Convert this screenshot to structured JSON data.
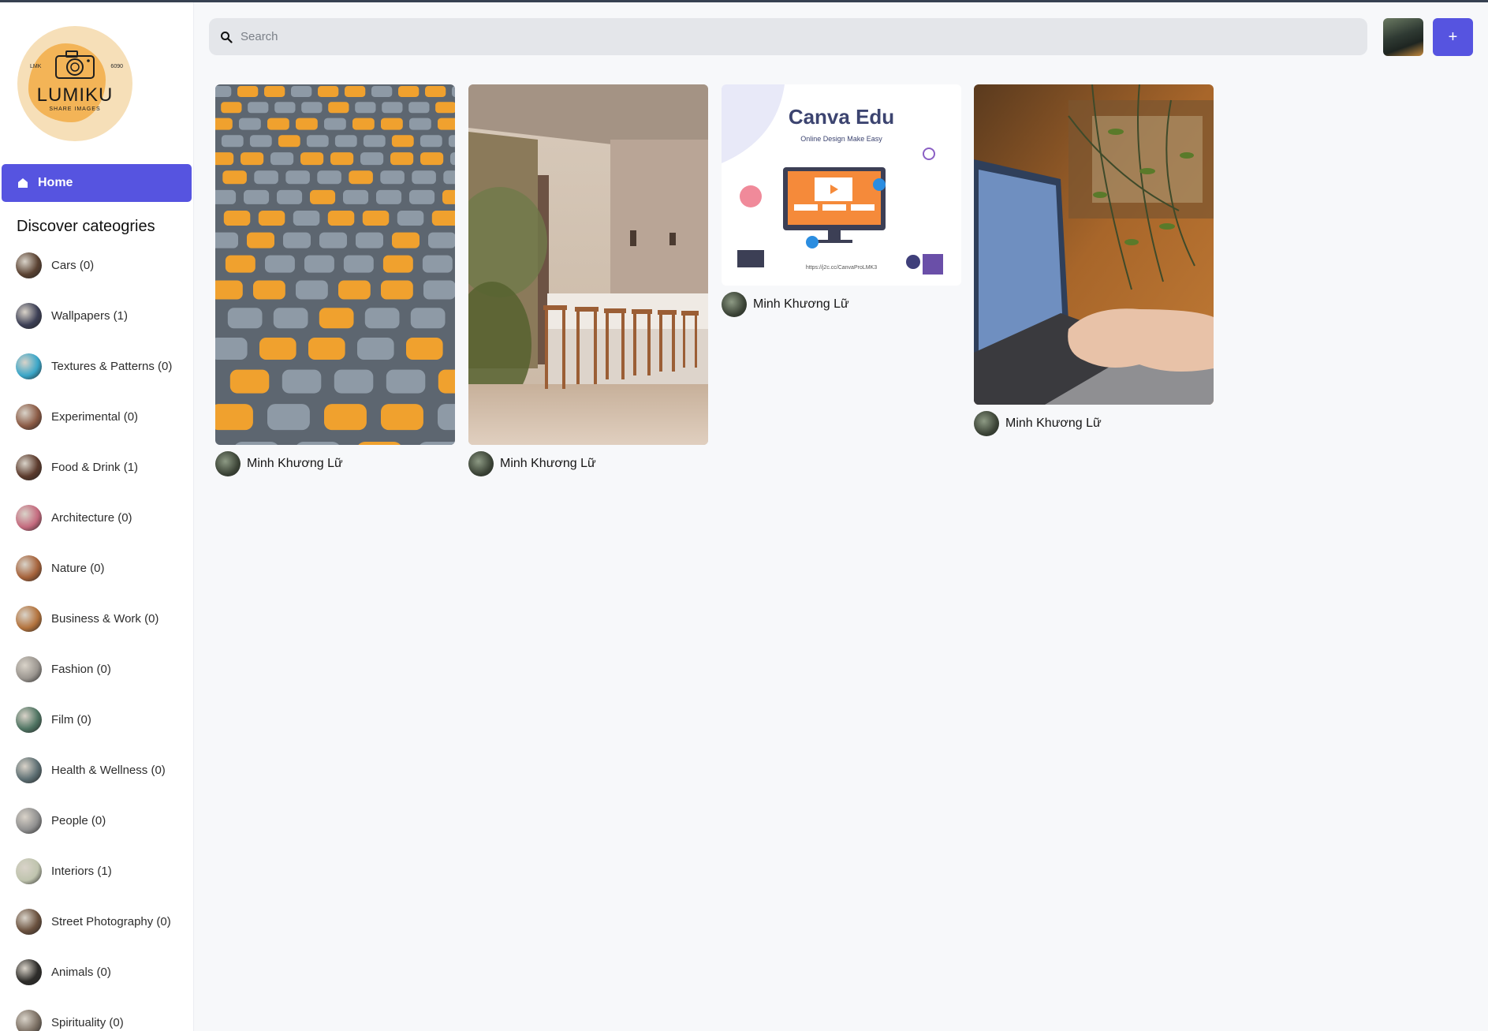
{
  "app": {
    "logo_small_left": "LMK",
    "logo_small_right": "6090",
    "logo_word": "LUMIKU",
    "logo_tagline": "SHARE IMAGES"
  },
  "sidebar": {
    "home_label": "Home",
    "discover_title": "Discover cateogries",
    "categories": [
      {
        "label": "Cars (0)",
        "color": "#5a4232"
      },
      {
        "label": "Wallpapers (1)",
        "color": "#3c3f55"
      },
      {
        "label": "Textures & Patterns (0)",
        "color": "#3aa6c8"
      },
      {
        "label": "Experimental (0)",
        "color": "#8a5a44"
      },
      {
        "label": "Food & Drink (1)",
        "color": "#5b3a2c"
      },
      {
        "label": "Architecture (0)",
        "color": "#c46a7e"
      },
      {
        "label": "Nature (0)",
        "color": "#a5623a"
      },
      {
        "label": "Business & Work (0)",
        "color": "#b3733d"
      },
      {
        "label": "Fashion (0)",
        "color": "#9a958f"
      },
      {
        "label": "Film (0)",
        "color": "#4f7462"
      },
      {
        "label": "Health & Wellness (0)",
        "color": "#5c6e72"
      },
      {
        "label": "People (0)",
        "color": "#8f8f8f"
      },
      {
        "label": "Interiors (1)",
        "color": "#bfc4ae"
      },
      {
        "label": "Street Photography (0)",
        "color": "#6a513e"
      },
      {
        "label": "Animals (0)",
        "color": "#2e2d2a"
      },
      {
        "label": "Spirituality (0)",
        "color": "#7b6f63"
      }
    ]
  },
  "search": {
    "placeholder": "Search"
  },
  "header": {
    "add_label": "+"
  },
  "feed": {
    "cards": [
      {
        "author": "Minh Khương Lữ",
        "image": "stadium-seats-photo"
      },
      {
        "author": "Minh Khương Lữ",
        "image": "bar-stools-photo"
      },
      {
        "author": "Minh Khương Lữ",
        "image": "canva-edu-banner",
        "banner_title": "Canva Edu",
        "banner_subtitle": "Online Design Make Easy",
        "banner_url": "https://j2c.cc/CanvaProLMK3"
      },
      {
        "author": "Minh Khương Lữ",
        "image": "laptop-cafe-photo"
      }
    ]
  },
  "colors": {
    "accent": "#5654e0",
    "seat_orange": "#f0a12e",
    "seat_gray": "#8e9aa6"
  }
}
